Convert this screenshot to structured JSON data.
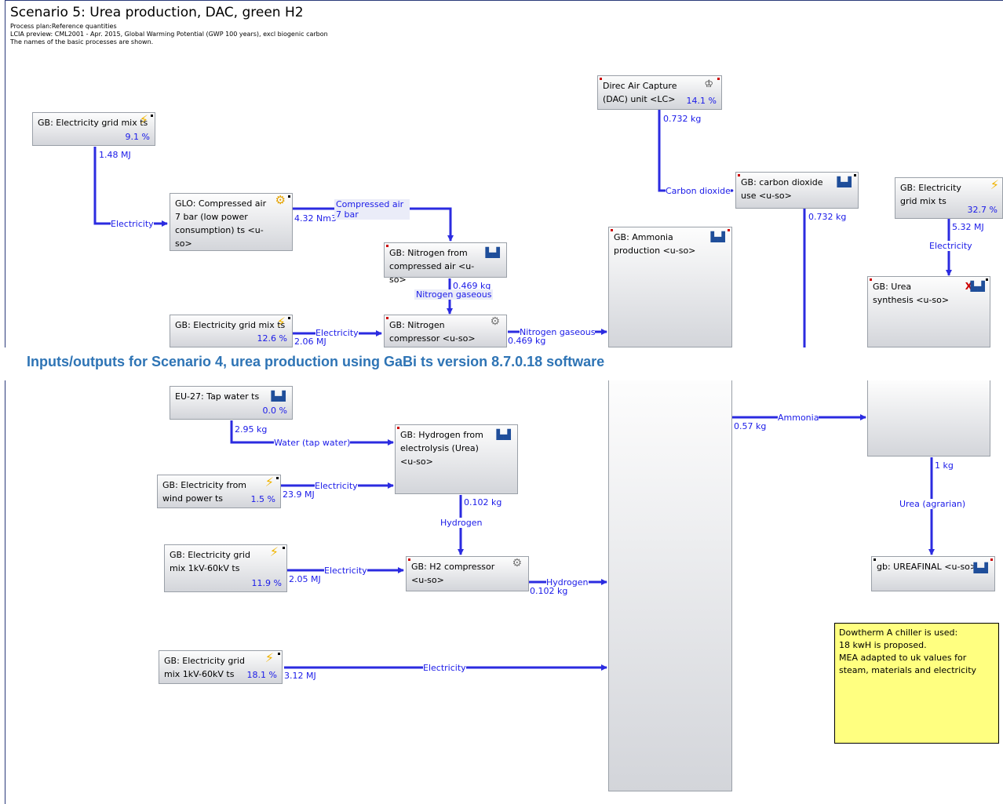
{
  "header": {
    "title": "Scenario 5: Urea production, DAC, green H2",
    "line1": "Process plan:Reference quantities",
    "line2": "LCIA preview: CML2001 - Apr. 2015, Global Warming Potential (GWP 100 years), excl biogenic carbon",
    "line3": "The names of the basic processes are shown."
  },
  "caption": "Inputs/outputs for Scenario 4, urea production using GaBi ts version 8.7.0.18 software",
  "processes": {
    "grid1": {
      "name": "GB: Electricity grid mix ts",
      "pct": "9.1 %"
    },
    "compressed_air": {
      "name": "GLO: Compressed air 7 bar (low power consumption) ts <u-so>"
    },
    "nitrogen_from_air": {
      "name": "GB: Nitrogen from compressed air <u-so>"
    },
    "grid2": {
      "name": "GB: Electricity grid mix ts",
      "pct": "12.6 %"
    },
    "nitrogen_compressor": {
      "name": "GB: Nitrogen compressor <u-so>"
    },
    "dac": {
      "name": "Direc Air Capture (DAC) unit <LC>",
      "pct": "14.1 %"
    },
    "co2_use": {
      "name": "GB: carbon dioxide use <u-so>"
    },
    "ammonia": {
      "name": "GB: Ammonia production <u-so>"
    },
    "grid3": {
      "name": "GB: Electricity grid mix ts",
      "pct": "32.7 %"
    },
    "urea_synthesis": {
      "name": "GB: Urea synthesis <u-so>"
    },
    "tap_water": {
      "name": "EU-27: Tap water ts",
      "pct": "0.0 %"
    },
    "hydrogen": {
      "name": "GB: Hydrogen from electrolysis (Urea) <u-so>"
    },
    "wind": {
      "name": "GB: Electricity from wind power ts",
      "pct": "1.5 %"
    },
    "grid4": {
      "name": "GB: Electricity grid mix 1kV-60kV ts",
      "pct": "11.9 %"
    },
    "h2_compressor": {
      "name": "GB: H2 compressor <u-so>"
    },
    "grid5": {
      "name": "GB: Electricity grid mix 1kV-60kV ts",
      "pct": "18.1 %"
    },
    "ureafinal": {
      "name": "gb: UREAFINAL <u-so>"
    }
  },
  "flows": {
    "elec1": {
      "label": "Electricity",
      "qty": "1.48 MJ"
    },
    "air": {
      "label": "Compressed air 7 bar",
      "qty": "4.32 Nm3"
    },
    "n2_gas1": {
      "label": "Nitrogen gaseous",
      "qty": "0.469 kg"
    },
    "elec2": {
      "label": "Electricity",
      "qty": "2.06 MJ"
    },
    "n2_gas2": {
      "label": "Nitrogen gaseous",
      "qty": "0.469 kg"
    },
    "co2": {
      "label": "Carbon dioxide",
      "qty": "0.732 kg"
    },
    "co2_out": {
      "qty": "0.732 kg"
    },
    "elec3": {
      "label": "Electricity",
      "qty": "5.32 MJ"
    },
    "water": {
      "label": "Water (tap water)",
      "qty": "2.95 kg"
    },
    "elec_wind": {
      "label": "Electricity",
      "qty": "23.9 MJ"
    },
    "h2": {
      "label": "Hydrogen",
      "qty": "0.102 kg"
    },
    "elec4": {
      "label": "Electricity",
      "qty": "2.05 MJ"
    },
    "h2_out": {
      "label": "Hydrogen",
      "qty": "0.102 kg"
    },
    "elec5": {
      "label": "Electricity",
      "qty": "3.12 MJ"
    },
    "ammonia": {
      "label": "Ammonia",
      "qty": "0.57 kg"
    },
    "urea": {
      "label": "Urea (agrarian)",
      "qty": "1 kg"
    }
  },
  "note": {
    "line1": "Dowtherm A chiller is used:",
    "line2": "18 kwH is proposed.",
    "line3": "MEA adapted to uk values for steam, materials and electricity"
  },
  "colors": {
    "flow": "#2b2be0",
    "pct": "#1a1ae8",
    "caption": "#2e74b5",
    "note_bg": "#ffff80"
  }
}
